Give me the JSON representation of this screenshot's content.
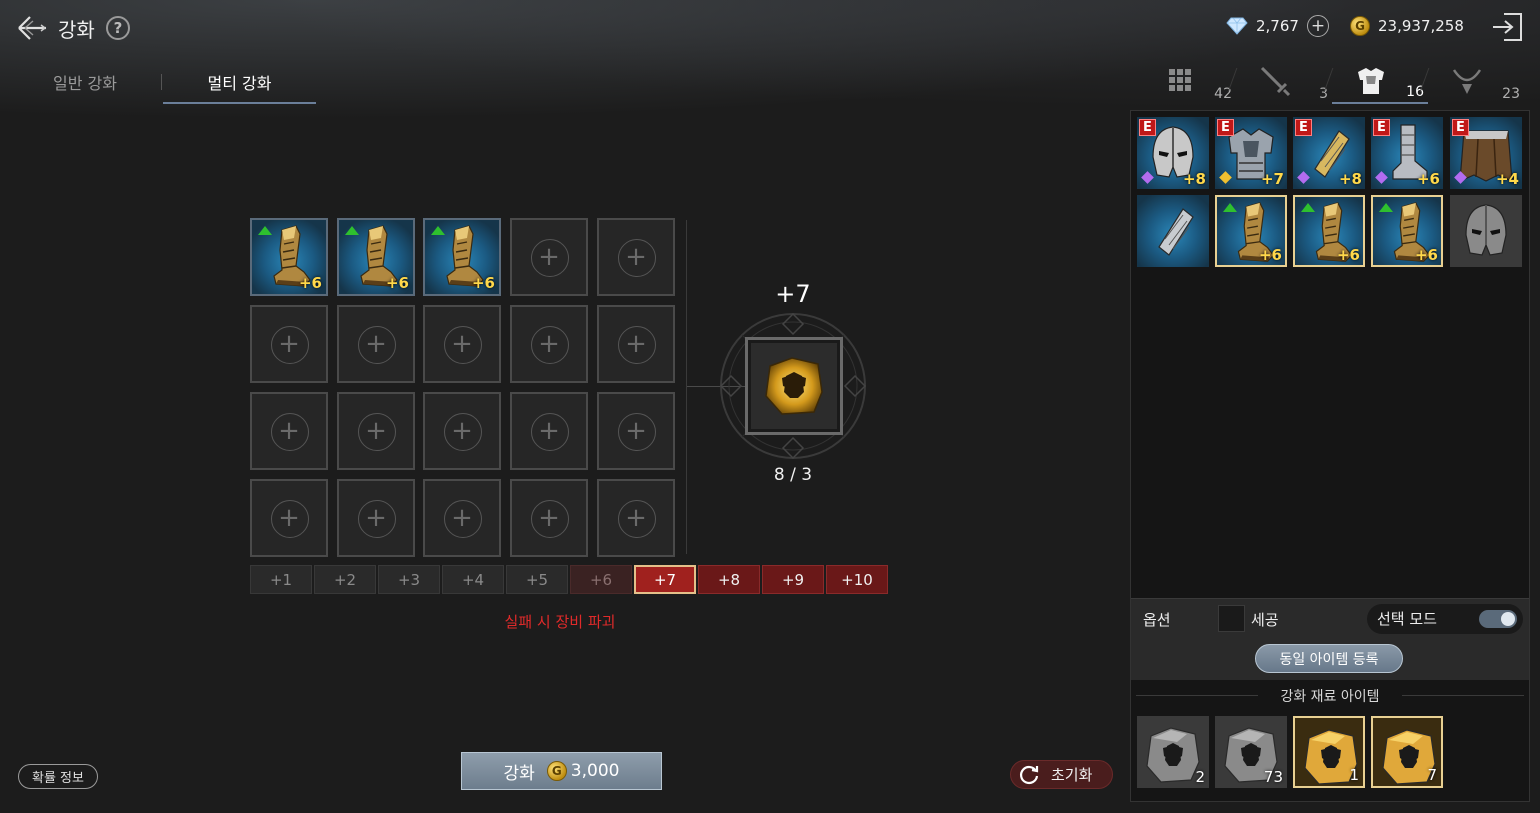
{
  "header": {
    "title": "강화",
    "help_label": "?",
    "gems": "2,767",
    "gold": "23,937,258",
    "gold_symbol": "G"
  },
  "mode_tabs": [
    {
      "label": "일반 강화",
      "active": false
    },
    {
      "label": "멀티 강화",
      "active": true
    }
  ],
  "grid": {
    "slots": [
      {
        "filled": true,
        "level": "+6",
        "upgradable": true
      },
      {
        "filled": true,
        "level": "+6",
        "upgradable": true
      },
      {
        "filled": true,
        "level": "+6",
        "upgradable": true
      },
      {
        "filled": false
      },
      {
        "filled": false
      },
      {
        "filled": false
      },
      {
        "filled": false
      },
      {
        "filled": false
      },
      {
        "filled": false
      },
      {
        "filled": false
      },
      {
        "filled": false
      },
      {
        "filled": false
      },
      {
        "filled": false
      },
      {
        "filled": false
      },
      {
        "filled": false
      },
      {
        "filled": false
      },
      {
        "filled": false
      },
      {
        "filled": false
      },
      {
        "filled": false
      },
      {
        "filled": false
      }
    ],
    "empty_symbol": "+"
  },
  "level_tabs": [
    {
      "label": "+1",
      "state": "dim"
    },
    {
      "label": "+2",
      "state": "dim"
    },
    {
      "label": "+3",
      "state": "dim"
    },
    {
      "label": "+4",
      "state": "dim"
    },
    {
      "label": "+5",
      "state": "dim"
    },
    {
      "label": "+6",
      "state": "dark"
    },
    {
      "label": "+7",
      "state": "sel"
    },
    {
      "label": "+8",
      "state": "red"
    },
    {
      "label": "+9",
      "state": "red"
    },
    {
      "label": "+10",
      "state": "red"
    }
  ],
  "warning": "실패 시 장비 파괴",
  "target": {
    "level": "+7",
    "count": "8 / 3"
  },
  "buttons": {
    "probability": "확률 정보",
    "enhance": "강화",
    "enhance_cost": "3,000",
    "reset": "초기화"
  },
  "category_tabs": [
    {
      "icon": "grid-icon",
      "count": "42",
      "active": false
    },
    {
      "icon": "sword-icon",
      "count": "3",
      "active": false
    },
    {
      "icon": "armor-icon",
      "count": "16",
      "active": true
    },
    {
      "icon": "necklace-icon",
      "count": "23",
      "active": false
    }
  ],
  "inventory": [
    {
      "icon": "helmet-icon",
      "equipped": true,
      "badge": "E",
      "grade_color": "#b36cf0",
      "level": "+8",
      "selected": false
    },
    {
      "icon": "chest-armor-icon",
      "equipped": true,
      "badge": "E",
      "grade_color": "#f0c030",
      "level": "+7",
      "selected": false
    },
    {
      "icon": "bracer-icon",
      "equipped": true,
      "badge": "E",
      "grade_color": "#b36cf0",
      "level": "+8",
      "selected": false
    },
    {
      "icon": "boots-icon",
      "equipped": true,
      "badge": "E",
      "grade_color": "#b36cf0",
      "level": "+6",
      "selected": false
    },
    {
      "icon": "cape-icon",
      "equipped": true,
      "badge": "E",
      "grade_color": "#b36cf0",
      "level": "+4",
      "selected": false
    },
    {
      "icon": "bracer-icon",
      "equipped": false,
      "level": "",
      "selected": false
    },
    {
      "icon": "boots-icon",
      "equipped": false,
      "level": "+6",
      "selected": true,
      "upgradable": true
    },
    {
      "icon": "boots-icon",
      "equipped": false,
      "level": "+6",
      "selected": true,
      "upgradable": true
    },
    {
      "icon": "boots-icon",
      "equipped": false,
      "level": "+6",
      "selected": true,
      "upgradable": true
    },
    {
      "icon": "helmet-icon",
      "equipped": false,
      "level": "",
      "selected": false
    }
  ],
  "options": {
    "label": "옵션",
    "polish": "세공",
    "select_mode": "선택 모드",
    "register_same": "동일 아이템 등록"
  },
  "materials": {
    "title": "강화 재료 아이템",
    "items": [
      {
        "icon": "armor-stone-icon",
        "tier": "grey",
        "count": "2",
        "selected": false
      },
      {
        "icon": "armor-stone-icon",
        "tier": "grey",
        "count": "73",
        "selected": false
      },
      {
        "icon": "armor-stone-icon",
        "tier": "gold",
        "count": "1",
        "selected": true
      },
      {
        "icon": "armor-stone-icon",
        "tier": "gold",
        "count": "7",
        "selected": true
      }
    ]
  },
  "colors": {
    "accent_red": "#a0211e",
    "warning_red": "#e02a2a",
    "level_yellow": "#ffd84a",
    "selection_gold": "#e8d092"
  }
}
